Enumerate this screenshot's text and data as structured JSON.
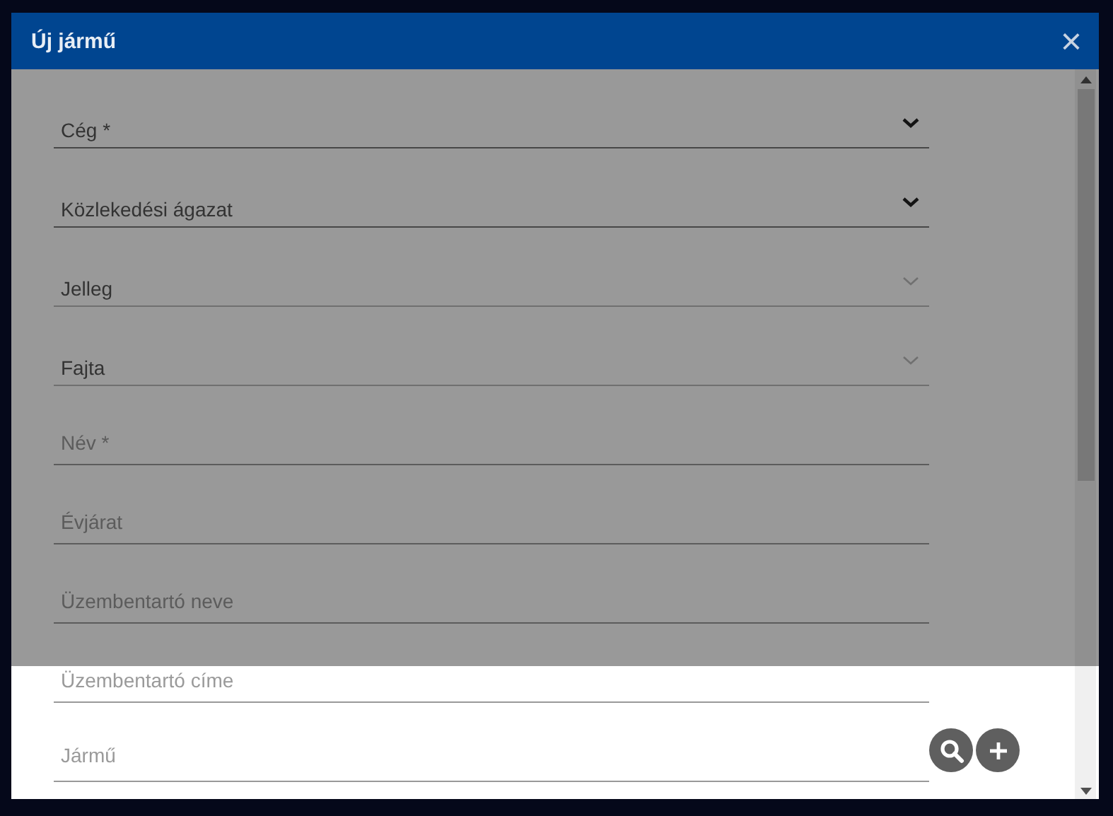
{
  "dialog": {
    "title": "Új jármű",
    "close": "×"
  },
  "fields": [
    {
      "kind": "select",
      "placeholder": "Cég *",
      "disabled": false
    },
    {
      "kind": "select",
      "placeholder": "Közlekedési ágazat",
      "disabled": false
    },
    {
      "kind": "select",
      "placeholder": "Jelleg",
      "disabled": true
    },
    {
      "kind": "select",
      "placeholder": "Fajta",
      "disabled": true
    },
    {
      "kind": "text",
      "placeholder": "Név *"
    },
    {
      "kind": "text",
      "placeholder": "Évjárat"
    },
    {
      "kind": "text",
      "placeholder": "Üzembentartó neve"
    },
    {
      "kind": "text",
      "placeholder": "Üzembentartó címe"
    },
    {
      "kind": "lookup",
      "placeholder": "Jármű"
    }
  ]
}
